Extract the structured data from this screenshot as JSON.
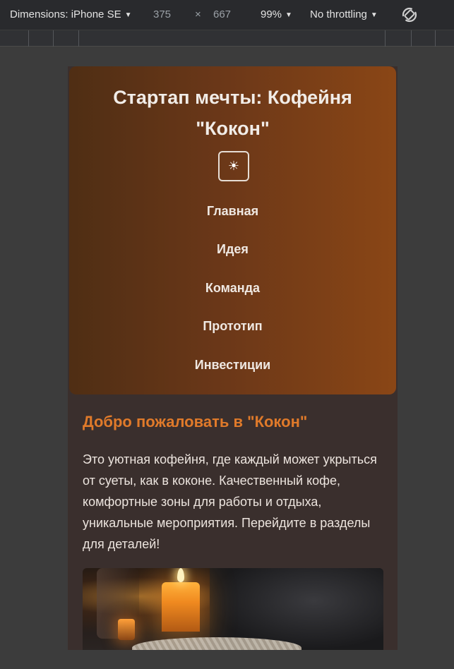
{
  "devtools": {
    "dimensions_label": "Dimensions: iPhone SE",
    "width": "375",
    "times": "×",
    "height": "667",
    "zoom": "99%",
    "throttling": "No throttling"
  },
  "site": {
    "title": "Стартап мечты: Кофейня \"Кокон\"",
    "theme_toggle_icon": "☀",
    "nav": [
      "Главная",
      "Идея",
      "Команда",
      "Прототип",
      "Инвестиции"
    ],
    "welcome_title": "Добро пожаловать в \"Кокон\"",
    "welcome_text": "Это уютная кофейня, где каждый может укрыться от суеты, как в коконе. Качественный кофе, комфортные зоны для работы и отдыха, уникальные мероприятия. Перейдите в разделы для деталей!"
  },
  "colors": {
    "header_gradient_start": "#4f2e14",
    "header_gradient_end": "#8a4616",
    "accent": "#e07a2a",
    "content_bg": "#3a2f2d"
  },
  "icons": {
    "rotate": "rotate-icon",
    "theme": "sun-icon"
  }
}
